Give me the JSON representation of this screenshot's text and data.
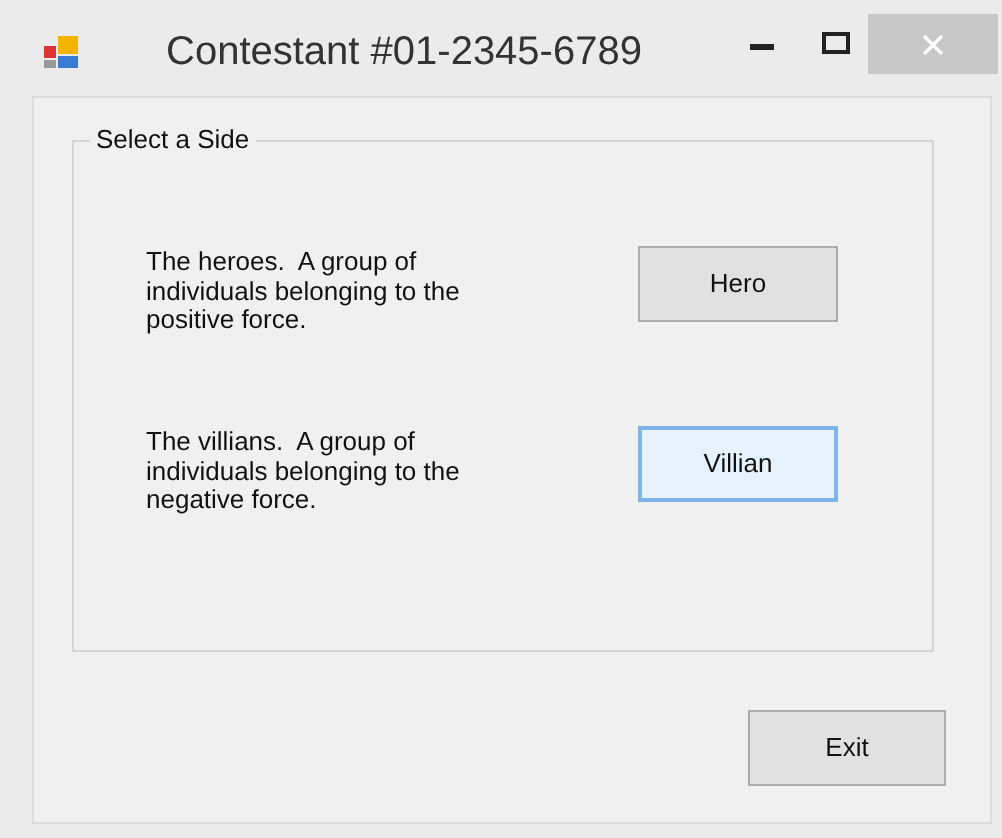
{
  "window": {
    "title": "Contestant #01-2345-6789"
  },
  "group": {
    "title": "Select a Side",
    "options": [
      {
        "description": "The heroes.  A group of individuals belonging to the positive force.",
        "button": "Hero",
        "focused": false
      },
      {
        "description": "The villians.  A group of individuals belonging to the negative force.",
        "button": "Villian",
        "focused": true
      }
    ]
  },
  "buttons": [
    {
      "label": "Exit",
      "focused": false
    }
  ]
}
